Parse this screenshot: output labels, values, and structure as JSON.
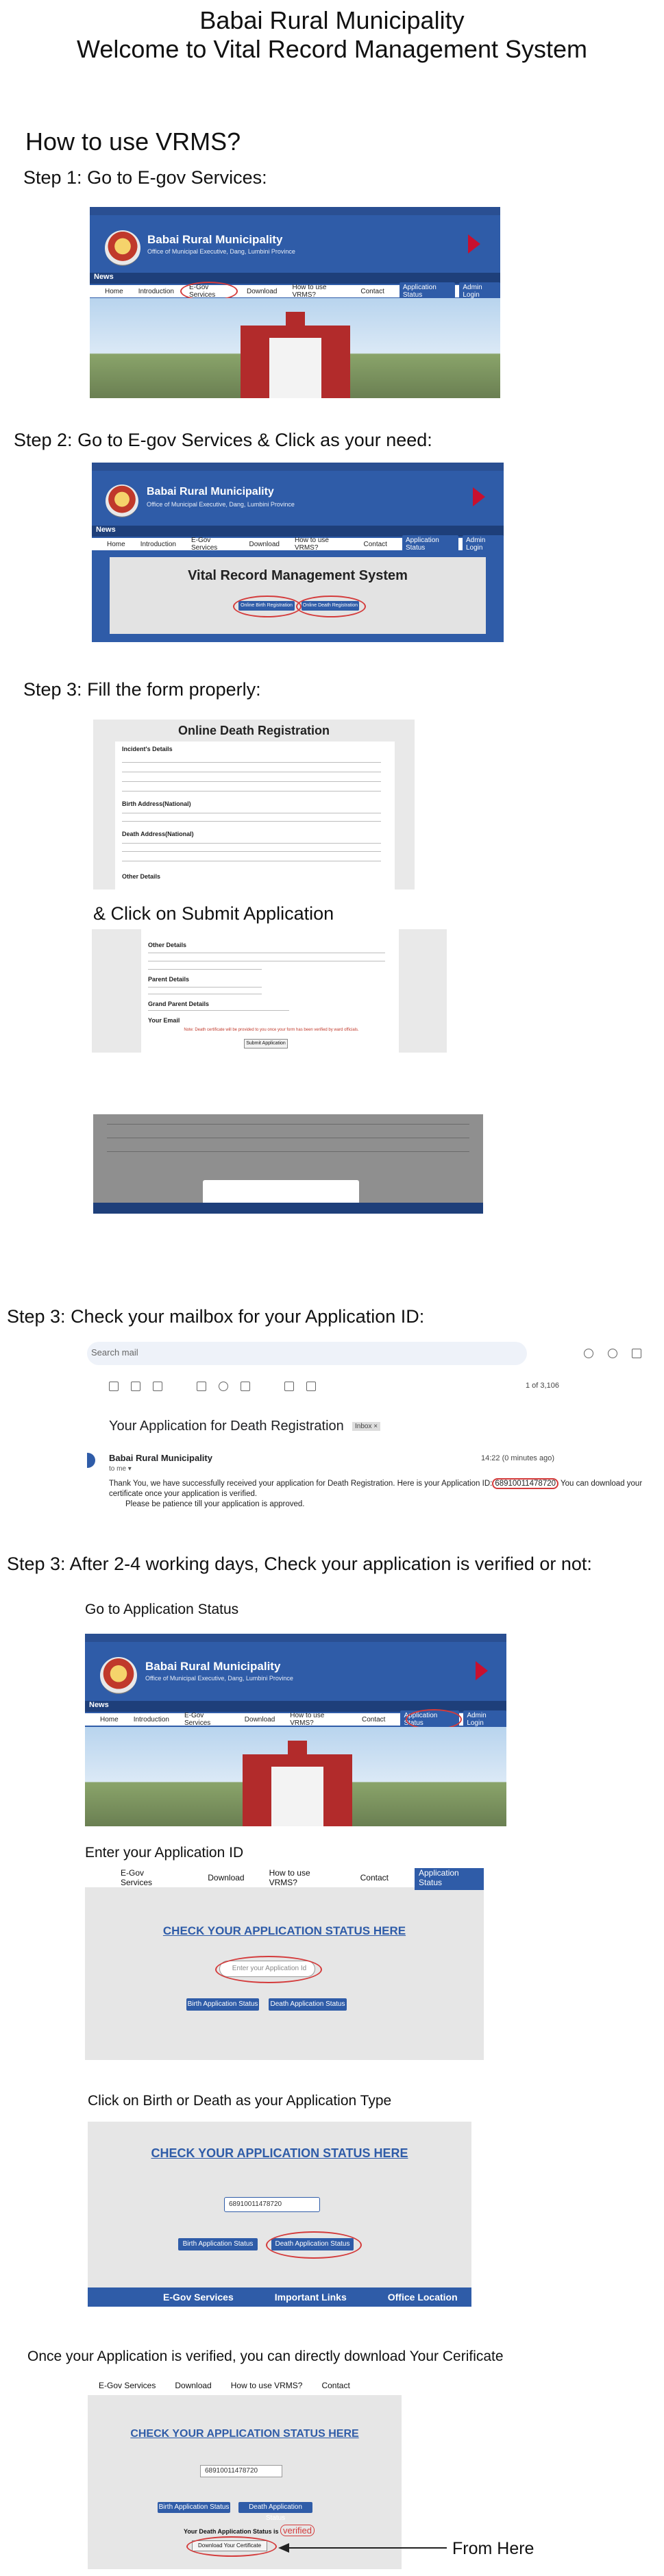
{
  "header": {
    "municipality": "Babai Rural Municipality",
    "welcome": "Welcome to Vital Record Management System",
    "how_to": "How to use VRMS?"
  },
  "steps": {
    "s1": "Step 1: Go to E-gov Services:",
    "s2": "Step 2: Go to E-gov Services & Click as your need:",
    "s3": "Step 3: Fill the form properly:",
    "s3b": "& Click on Submit Application",
    "s4": "Step 3: Check your mailbox for your Application ID:",
    "s5": "Step 3: After 2-4 working days, Check your application is verified or not:",
    "go_status": "Go to Application Status",
    "enter_id": "Enter your Application ID",
    "click_type": "Click on Birth or Death as your Application Type",
    "download_note": "Once your Application is verified, you can directly download Your Cerificate",
    "from_here": "From Here"
  },
  "site": {
    "name": "Babai Rural Municipality",
    "subtitle": "Office of Municipal Executive, Dang, Lumbini Province",
    "news": "News",
    "nav": [
      "Home",
      "Introduction",
      "E-Gov Services",
      "Download",
      "How to use VRMS?",
      "Contact"
    ],
    "nav_btn1": "Application Status",
    "nav_btn2": "Admin Login"
  },
  "vrms_panel": {
    "title": "Vital Record Management System",
    "birth_btn": "Online Birth Registration",
    "death_btn": "Online Death Registration"
  },
  "death_form": {
    "title": "Online Death Registration",
    "sections": [
      "Incident's Details",
      "Birth Address(National)",
      "Death Address(National)",
      "Other Details"
    ],
    "sections2": [
      "Other Details",
      "Parent Details",
      "Grand Parent Details"
    ],
    "email_label": "Your Email",
    "submit": "Submit Application",
    "note": "Note: Death certificate will be provided to you once your form has been verified by ward officials."
  },
  "gmail": {
    "search_placeholder": "Search mail",
    "pager": "1 of 3,106",
    "subject": "Your Application for Death Registration",
    "inbox_tag": "Inbox ×",
    "sender": "Babai Rural Municipality",
    "to": "to me ▾",
    "time": "14:22 (0 minutes ago)",
    "body1": "Thank You, we have successfully received your application for Death Registration. Here is your Application ID:",
    "app_id": "68910011478720",
    "body2": "You can download your certificate once your application is verified.",
    "body3": "Please be patience till your application is approved."
  },
  "status_page": {
    "heading": "CHECK YOUR APPLICATION STATUS HERE",
    "placeholder": "Enter your Application Id",
    "birth_btn": "Birth Application Status",
    "death_btn": "Death Application Status",
    "app_id": "68910011478720",
    "verified_label": "Your Death Application Status is",
    "verified": "verified",
    "download_btn": "Download Your Certificate",
    "footer": [
      "E-Gov Services",
      "Important Links",
      "Office Location"
    ]
  }
}
